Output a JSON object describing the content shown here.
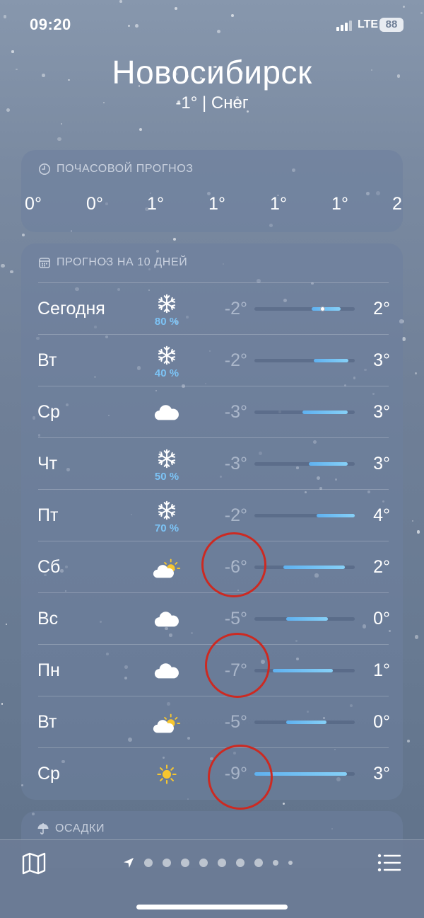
{
  "status_bar": {
    "time": "09:20",
    "network": "LTE",
    "battery": "88"
  },
  "header": {
    "city": "Новосибирск",
    "subtitle": "-1° | Снег"
  },
  "hourly": {
    "title": "ПОЧАСОВОЙ ПРОГНОЗ",
    "values": [
      "0°",
      "0°",
      "1°",
      "1°",
      "1°",
      "1°",
      "2"
    ]
  },
  "daily": {
    "title": "ПРОГНОЗ НА 10 ДНЕЙ",
    "days": [
      {
        "name": "Сегодня",
        "icon": "snowflake-icon",
        "precip": "80 %",
        "low": "-2°",
        "high": "2°",
        "range_from": 0.57,
        "range_to": 0.86,
        "current": 0.68
      },
      {
        "name": "Вт",
        "icon": "snowflake-icon",
        "precip": "40 %",
        "low": "-2°",
        "high": "3°",
        "range_from": 0.59,
        "range_to": 0.94
      },
      {
        "name": "Ср",
        "icon": "cloud-icon",
        "precip": "",
        "low": "-3°",
        "high": "3°",
        "range_from": 0.48,
        "range_to": 0.93
      },
      {
        "name": "Чт",
        "icon": "snowflake-icon",
        "precip": "50 %",
        "low": "-3°",
        "high": "3°",
        "range_from": 0.54,
        "range_to": 0.93
      },
      {
        "name": "Пт",
        "icon": "snowflake-icon",
        "precip": "70 %",
        "low": "-2°",
        "high": "4°",
        "range_from": 0.62,
        "range_to": 1.0
      },
      {
        "name": "Сб",
        "icon": "partly-sunny-icon",
        "precip": "",
        "low": "-6°",
        "high": "2°",
        "range_from": 0.29,
        "range_to": 0.9
      },
      {
        "name": "Вс",
        "icon": "cloud-icon",
        "precip": "",
        "low": "-5°",
        "high": "0°",
        "range_from": 0.32,
        "range_to": 0.73
      },
      {
        "name": "Пн",
        "icon": "cloud-icon",
        "precip": "",
        "low": "-7°",
        "high": "1°",
        "range_from": 0.18,
        "range_to": 0.78
      },
      {
        "name": "Вт",
        "icon": "partly-sunny-icon",
        "precip": "",
        "low": "-5°",
        "high": "0°",
        "range_from": 0.32,
        "range_to": 0.72
      },
      {
        "name": "Ср",
        "icon": "sun-icon",
        "precip": "",
        "low": "-9°",
        "high": "3°",
        "range_from": 0.0,
        "range_to": 0.92
      }
    ]
  },
  "precipitation": {
    "title": "ОСАДКИ"
  },
  "colors": {
    "annotation_circle": "#cc2a22",
    "precip_text": "#7cc3f5",
    "sun": "#f6c630"
  }
}
